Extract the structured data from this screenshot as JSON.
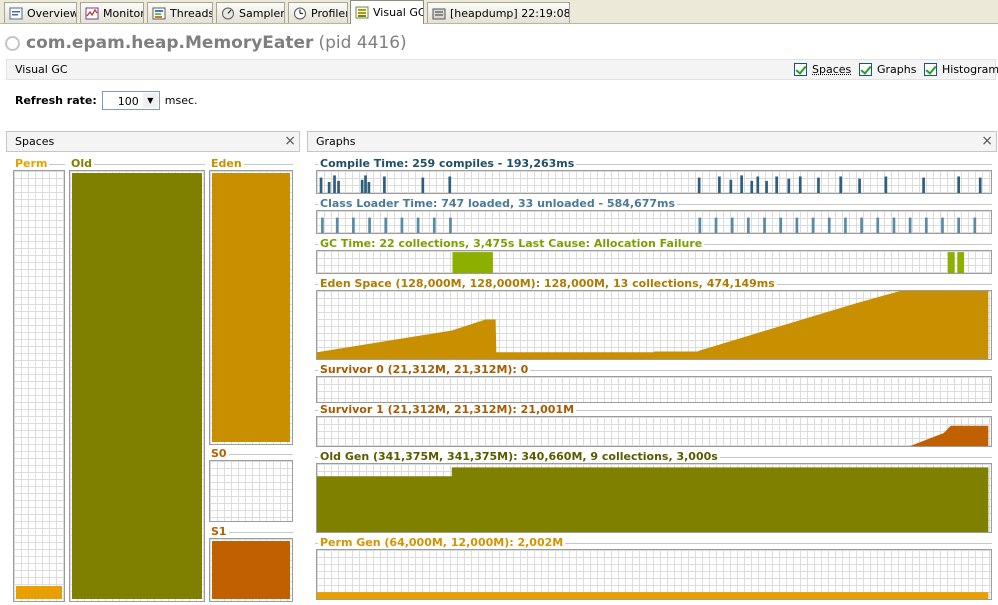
{
  "tabs": [
    {
      "label": "Overview",
      "icon": "overview-icon"
    },
    {
      "label": "Monitor",
      "icon": "monitor-icon"
    },
    {
      "label": "Threads",
      "icon": "threads-icon"
    },
    {
      "label": "Sampler",
      "icon": "sampler-icon"
    },
    {
      "label": "Profiler",
      "icon": "profiler-icon"
    },
    {
      "label": "Visual GC",
      "icon": "visual-gc-icon"
    },
    {
      "label": "[heapdump] 22:19:08",
      "icon": "heapdump-icon"
    }
  ],
  "tab_close": "×",
  "app": {
    "name": "com.epam.heap.MemoryEater",
    "pid": "(pid 4416)"
  },
  "visual_gc_bar": {
    "title": "Visual GC",
    "checkboxes": [
      {
        "label": "Spaces",
        "checked": true
      },
      {
        "label": "Graphs",
        "checked": true
      },
      {
        "label": "Histogram",
        "checked": true
      }
    ]
  },
  "refresh": {
    "label": "Refresh rate:",
    "value": "100",
    "unit": "msec."
  },
  "panels": {
    "spaces": "Spaces",
    "graphs": "Graphs",
    "close": "×"
  },
  "spaces": [
    {
      "name": "Perm",
      "fill_fraction": 0.03,
      "color": "#e8a000"
    },
    {
      "name": "Old",
      "fill_fraction": 1.0,
      "color": "#808000"
    },
    {
      "name": "Eden",
      "fill_fraction": 1.0,
      "color": "#c89000"
    },
    {
      "name": "S0",
      "fill_fraction": 0.0,
      "color": "#c06000"
    },
    {
      "name": "S1",
      "fill_fraction": 1.0,
      "color": "#c06000"
    }
  ],
  "graphs": [
    {
      "title": "Compile Time: 259 compiles - 193,263ms",
      "color": "#2e5f7f"
    },
    {
      "title": "Class Loader Time: 747 loaded, 33 unloaded - 584,677ms",
      "color": "#5a8aa8"
    },
    {
      "title": "GC Time: 22 collections, 3,475s  Last Cause: Allocation Failure",
      "color": "#8db000"
    },
    {
      "title": "Eden Space (128,000M, 128,000M): 128,000M, 13 collections, 474,149ms",
      "color": "#c89000"
    },
    {
      "title": "Survivor 0 (21,312M, 21,312M): 0",
      "color": "#b86000"
    },
    {
      "title": "Survivor 1 (21,312M, 21,312M): 21,001M",
      "color": "#b86000"
    },
    {
      "title": "Old Gen (341,375M, 341,375M): 340,660M, 9 collections, 3,000s",
      "color": "#6e6e00"
    },
    {
      "title": "Perm Gen (64,000M, 12,000M): 2,002M",
      "color": "#e0a000"
    }
  ]
}
